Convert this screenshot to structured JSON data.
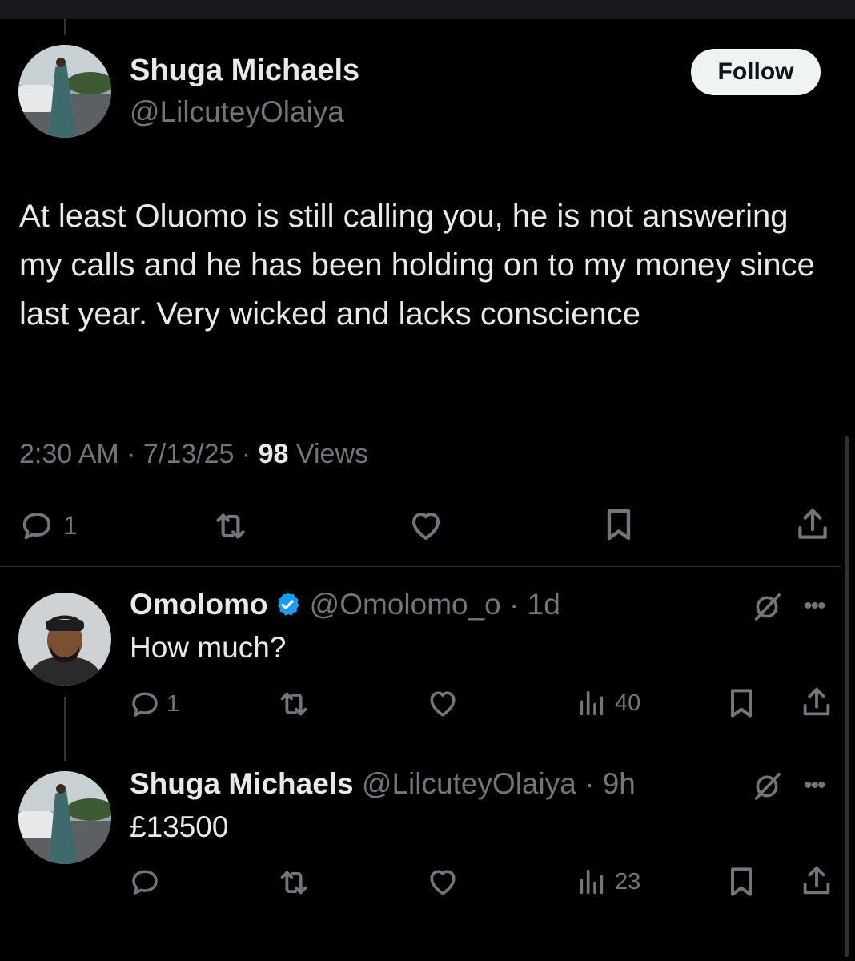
{
  "main_tweet": {
    "author_name": "Shuga Michaels",
    "author_handle": "@LilcuteyOlaiya",
    "follow_label": "Follow",
    "text": "At least Oluomo is still calling you, he is not answering my calls and he has been holding on to my money since last year. Very wicked and lacks conscience",
    "time": "2:30 AM",
    "date": "7/13/25",
    "views_count": "98",
    "views_label": "Views",
    "reply_count": "1"
  },
  "replies": [
    {
      "author_name": "Omolomo",
      "author_handle": "@Omolomo_o",
      "age": "1d",
      "text": "How much?",
      "reply_count": "1",
      "views": "40",
      "verified": true
    },
    {
      "author_name": "Shuga Michaels",
      "author_handle": "@LilcuteyOlaiya",
      "age": "9h",
      "text": "£13500",
      "views": "23"
    }
  ],
  "colors": {
    "background": "#000000",
    "text": "#e7e9ea",
    "muted": "#71767b",
    "verified": "#1d9bf0",
    "divider": "#2f3336"
  },
  "icons": [
    "reply-icon",
    "retweet-icon",
    "like-icon",
    "bookmark-icon",
    "share-icon",
    "views-icon",
    "grok-icon",
    "more-icon",
    "verified-badge-icon"
  ]
}
